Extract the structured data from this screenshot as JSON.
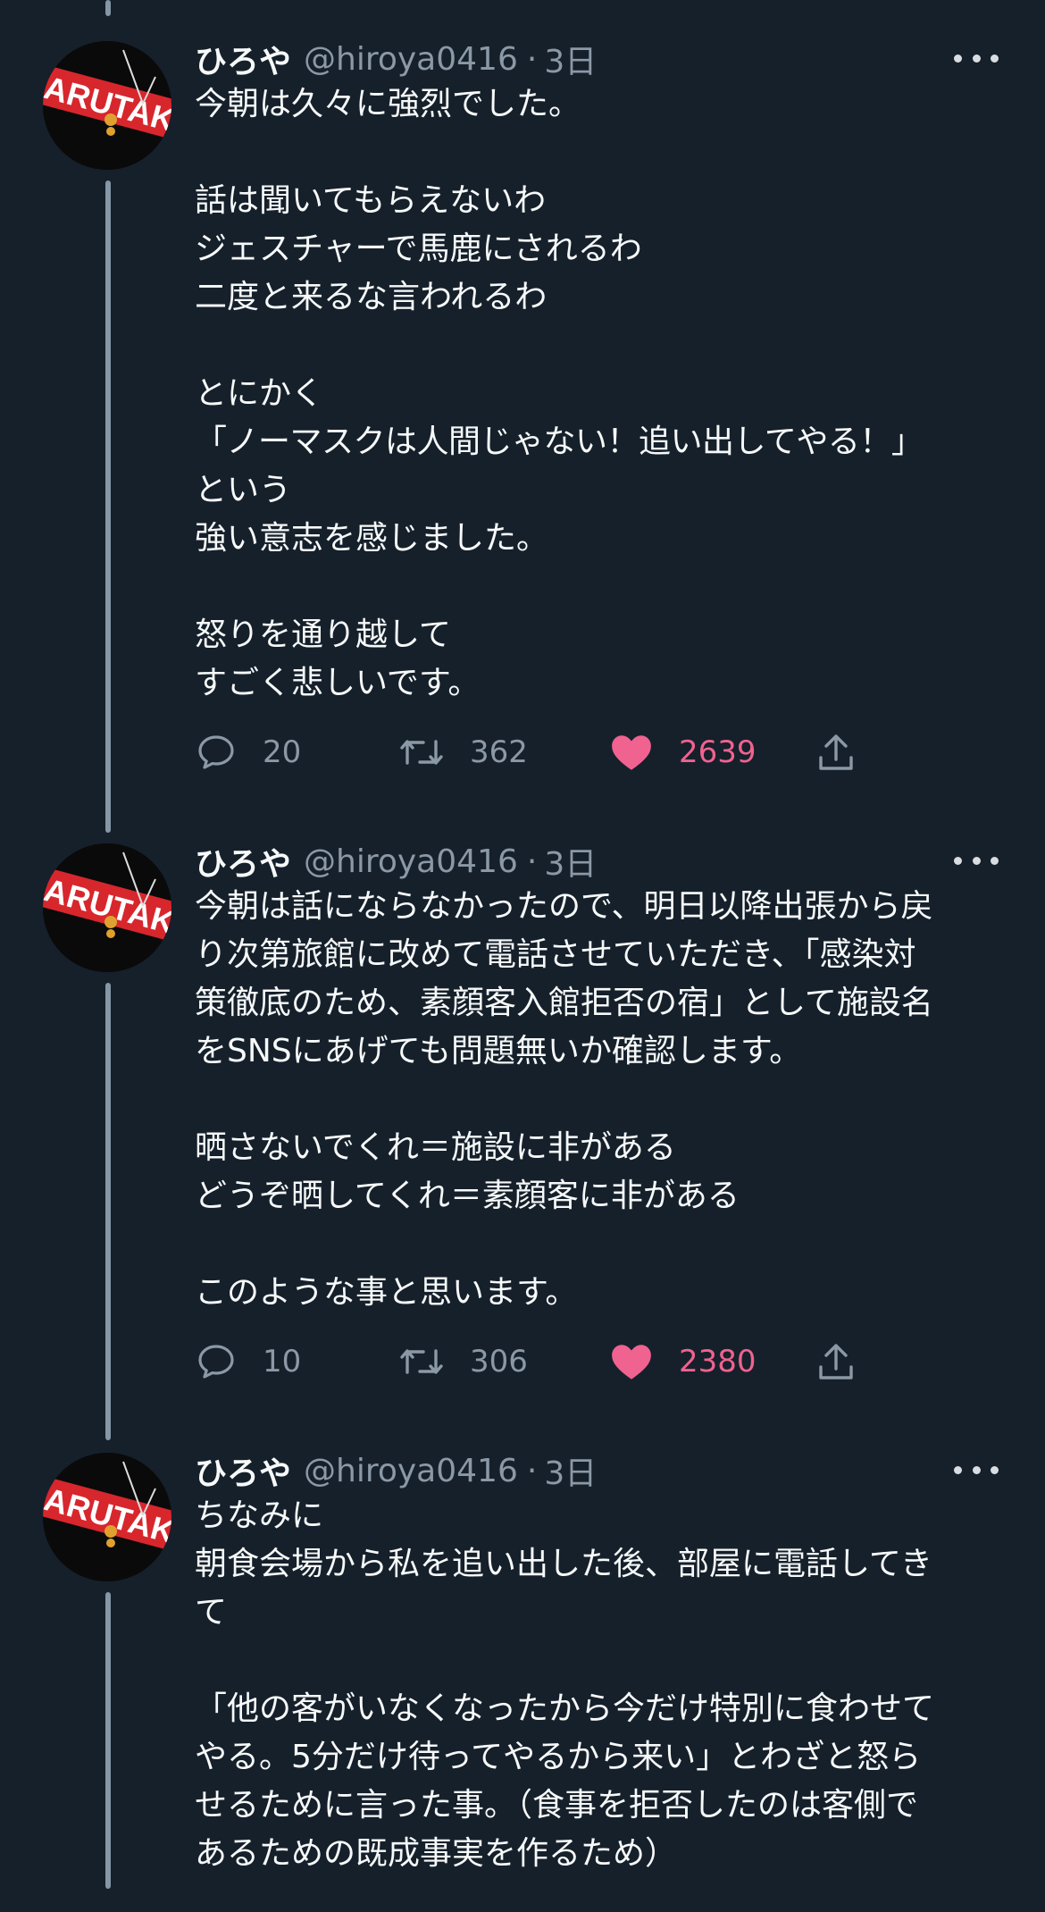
{
  "tweets": [
    {
      "name": "ひろや",
      "handle": "@hiroya0416",
      "separator": "·",
      "time": "3日",
      "body": [
        "今朝は久々に強烈でした。",
        "",
        "話は聞いてもらえないわ",
        "ジェスチャーで馬鹿にされるわ",
        "二度と来るな言われるわ",
        "",
        "とにかく",
        "「ノーマスクは人間じゃない！追い出してやる！」",
        "という",
        "強い意志を感じました。",
        "",
        "怒りを通り越して",
        "すごく悲しいです。"
      ],
      "replies": "20",
      "retweets": "362",
      "likes": "2639",
      "liked": true
    },
    {
      "name": "ひろや",
      "handle": "@hiroya0416",
      "separator": "·",
      "time": "3日",
      "body": [
        "今朝は話にならなかったので、明日以降出張から戻",
        "り次第旅館に改めて電話させていただき、「感染対",
        "策徹底のため、素顔客入館拒否の宿」として施設名",
        "をSNSにあげても問題無いか確認します。",
        "",
        "晒さないでくれ＝施設に非がある",
        "どうぞ晒してくれ＝素顔客に非がある",
        "",
        "このような事と思います。"
      ],
      "replies": "10",
      "retweets": "306",
      "likes": "2380",
      "liked": true
    },
    {
      "name": "ひろや",
      "handle": "@hiroya0416",
      "separator": "·",
      "time": "3日",
      "body": [
        "ちなみに",
        "朝食会場から私を追い出した後、部屋に電話してき",
        "て",
        "",
        "「他の客がいなくなったから今だけ特別に食わせて",
        "やる。5分だけ待ってやるから来い」とわざと怒ら",
        "せるために言った事。（食事を拒否したのは客側で",
        "あるための既成事実を作るため）"
      ]
    }
  ],
  "avatar_text": "MARUTAKA",
  "icons": {
    "reply": "reply-icon",
    "retweet": "retweet-icon",
    "like": "heart-icon",
    "share": "share-icon",
    "more": "more-icon"
  },
  "colors": {
    "background": "#15202b",
    "text": "#f7f9f9",
    "secondary": "#8b98a5",
    "like": "#f0628f",
    "thread_line": "#8596a6",
    "avatar_red": "#d8262d"
  }
}
